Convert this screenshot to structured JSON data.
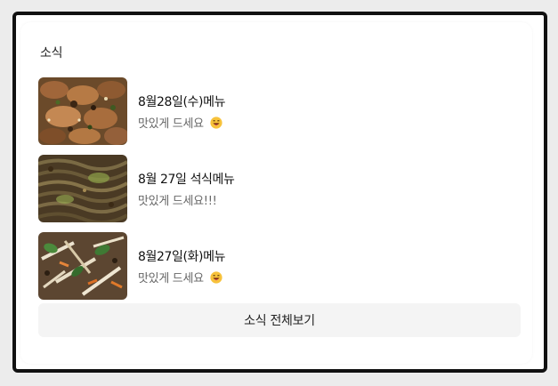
{
  "section": {
    "title": "소식"
  },
  "news_items": [
    {
      "title": "8월28일(수)메뉴",
      "subtitle": "맛있게 드세요",
      "has_emoji": true,
      "emoji_icon": "grinning-tongue-face-icon",
      "thumbnail_icon": "fried-meat-dish-photo"
    },
    {
      "title": "8월 27일 석식메뉴",
      "subtitle": "맛있게 드세요!!!",
      "has_emoji": false,
      "thumbnail_icon": "stir-fry-noodles-photo"
    },
    {
      "title": "8월27일(화)메뉴",
      "subtitle": "맛있게 드세요",
      "has_emoji": true,
      "emoji_icon": "grinning-tongue-face-icon",
      "thumbnail_icon": "vegetable-japchae-photo"
    }
  ],
  "footer": {
    "view_all_label": "소식 전체보기"
  },
  "colors": {
    "card_background": "#ffffff",
    "frame_border": "#111111",
    "button_background": "#f4f4f4",
    "subtitle_text": "#666666"
  }
}
